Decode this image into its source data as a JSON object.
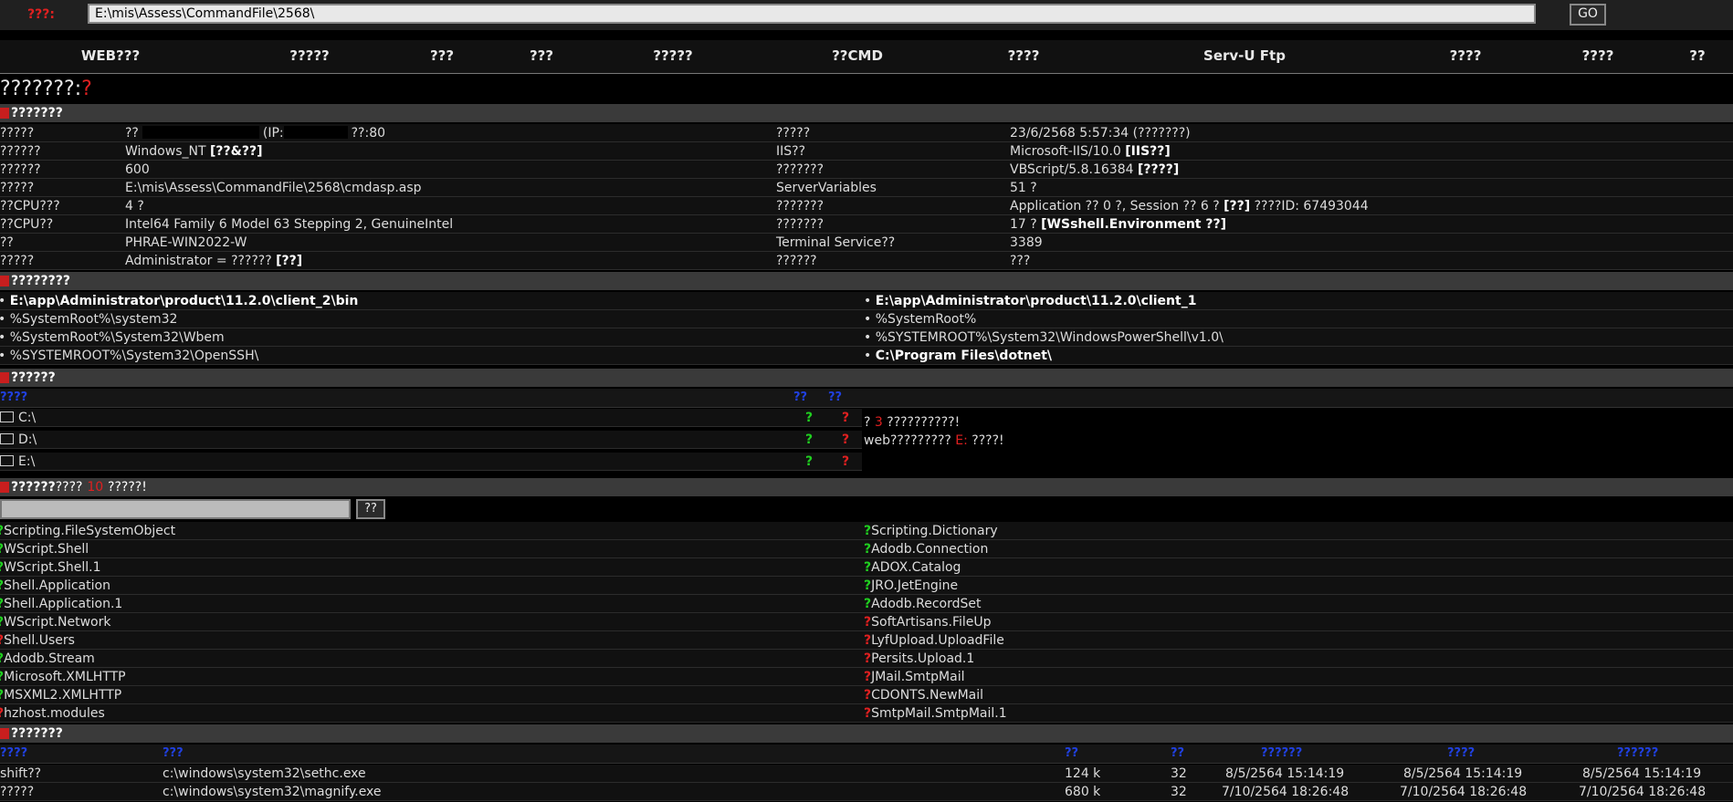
{
  "address": {
    "label": "???:",
    "value": "E:\\mis\\Assess\\CommandFile\\2568\\",
    "go": "GO"
  },
  "nav": [
    "WEB???",
    "?????",
    "???",
    "???",
    "?????",
    "??CMD",
    "????",
    "Serv-U Ftp",
    "????",
    "????",
    "??"
  ],
  "title": {
    "text": "???????:",
    "mark": "?"
  },
  "server_info": {
    "header": "???????",
    "rows": [
      {
        "k1": "?????",
        "v1a": "??",
        "v1b": "(IP:",
        "v1c": "??:80",
        "k2": "?????",
        "v2": "23/6/2568 5:57:34 (???????)"
      },
      {
        "k1": "??????",
        "v1": "Windows_NT",
        "v1bold": "[??&??]",
        "k2": "IIS??",
        "v2": "Microsoft-IIS/10.0",
        "v2bold": "[IIS??]"
      },
      {
        "k1": "??????",
        "v1": "600",
        "k2": "???????",
        "v2": "VBScript/5.8.16384",
        "v2bold": "[????]"
      },
      {
        "k1": "?????",
        "v1": "E:\\mis\\Assess\\CommandFile\\2568\\cmdasp.asp",
        "k2": "ServerVariables",
        "v2": "51 ?"
      },
      {
        "k1": "??CPU???",
        "v1": "4 ?",
        "k2": "???????",
        "v2": "Application ?? 0 ?, Session ?? 6 ?",
        "v2bold": "[??]",
        "v2tail": "????ID: 67493044"
      },
      {
        "k1": "??CPU??",
        "v1": "Intel64 Family 6 Model 63 Stepping 2, GenuineIntel",
        "k2": "???????",
        "v2": "17 ?",
        "v2bold": "[WSshell.Environment ??]"
      },
      {
        "k1": "??",
        "v1": "PHRAE-WIN2022-W",
        "k2": "Terminal Service??",
        "v2": "3389"
      },
      {
        "k1": "?????",
        "v1": "Administrator = ??????",
        "v1bold": "[??]",
        "k2": "??????",
        "v2": "???"
      }
    ]
  },
  "paths": {
    "header": "????????",
    "left": [
      {
        "text": "E:\\app\\Administrator\\product\\11.2.0\\client_2\\bin",
        "bold": true
      },
      {
        "text": "%SystemRoot%\\system32",
        "bold": false
      },
      {
        "text": "%SystemRoot%\\System32\\Wbem",
        "bold": false
      },
      {
        "text": "%SYSTEMROOT%\\System32\\OpenSSH\\",
        "bold": false
      }
    ],
    "right": [
      {
        "text": "E:\\app\\Administrator\\product\\11.2.0\\client_1",
        "bold": true
      },
      {
        "text": "%SystemRoot%",
        "bold": false
      },
      {
        "text": "%SYSTEMROOT%\\System32\\WindowsPowerShell\\v1.0\\",
        "bold": false
      },
      {
        "text": "C:\\Program Files\\dotnet\\",
        "bold": true
      }
    ]
  },
  "drives": {
    "header": "??????",
    "col1": "????",
    "col2": "??",
    "col3": "??",
    "items": [
      {
        "name": "C:\\",
        "ok": "?",
        "no": "?"
      },
      {
        "name": "D:\\",
        "ok": "?",
        "no": "?"
      },
      {
        "name": "E:\\",
        "ok": "?",
        "no": "?"
      }
    ],
    "msg1a": "?",
    "msg1n": "3",
    "msg1b": "??????????!",
    "msg2a": "web?????????",
    "msg2n": "E:",
    "msg2b": "????!"
  },
  "components": {
    "header": "??????",
    "header_b": "????",
    "header_n": "10",
    "header_c": "?????!",
    "search_btn": "??",
    "left": [
      {
        "mark": "?",
        "ok": true,
        "name": "Scripting.FileSystemObject"
      },
      {
        "mark": "?",
        "ok": true,
        "name": "WScript.Shell"
      },
      {
        "mark": "?",
        "ok": true,
        "name": "WScript.Shell.1"
      },
      {
        "mark": "?",
        "ok": true,
        "name": "Shell.Application"
      },
      {
        "mark": "?",
        "ok": true,
        "name": "Shell.Application.1"
      },
      {
        "mark": "?",
        "ok": true,
        "name": "WScript.Network"
      },
      {
        "mark": "?",
        "ok": false,
        "name": "Shell.Users"
      },
      {
        "mark": "?",
        "ok": true,
        "name": "Adodb.Stream"
      },
      {
        "mark": "?",
        "ok": true,
        "name": "Microsoft.XMLHTTP"
      },
      {
        "mark": "?",
        "ok": true,
        "name": "MSXML2.XMLHTTP"
      },
      {
        "mark": "?",
        "ok": false,
        "name": "hzhost.modules"
      }
    ],
    "right": [
      {
        "mark": "?",
        "ok": true,
        "name": "Scripting.Dictionary"
      },
      {
        "mark": "?",
        "ok": true,
        "name": "Adodb.Connection"
      },
      {
        "mark": "?",
        "ok": true,
        "name": "ADOX.Catalog"
      },
      {
        "mark": "?",
        "ok": true,
        "name": "JRO.JetEngine"
      },
      {
        "mark": "?",
        "ok": true,
        "name": "Adodb.RecordSet"
      },
      {
        "mark": "?",
        "ok": false,
        "name": "SoftArtisans.FileUp"
      },
      {
        "mark": "?",
        "ok": false,
        "name": "LyfUpload.UploadFile"
      },
      {
        "mark": "?",
        "ok": false,
        "name": "Persits.Upload.1"
      },
      {
        "mark": "?",
        "ok": false,
        "name": "JMail.SmtpMail"
      },
      {
        "mark": "?",
        "ok": false,
        "name": "CDONTS.NewMail"
      },
      {
        "mark": "?",
        "ok": false,
        "name": "SmtpMail.SmtpMail.1"
      }
    ]
  },
  "files": {
    "header": "???????",
    "cols": [
      "????",
      "???",
      "??",
      "??",
      "??????",
      "????",
      "??????"
    ],
    "rows": [
      {
        "name": "shift??",
        "path": "c:\\windows\\system32\\sethc.exe",
        "size": "124 k",
        "attr": "32",
        "created": "8/5/2564 15:14:19",
        "modified": "8/5/2564 15:14:19",
        "accessed": "8/5/2564 15:14:19"
      },
      {
        "name": "?????",
        "path": "c:\\windows\\system32\\magnify.exe",
        "size": "680 k",
        "attr": "32",
        "created": "7/10/2564 18:26:48",
        "modified": "7/10/2564 18:26:48",
        "accessed": "7/10/2564 18:26:48"
      }
    ]
  }
}
